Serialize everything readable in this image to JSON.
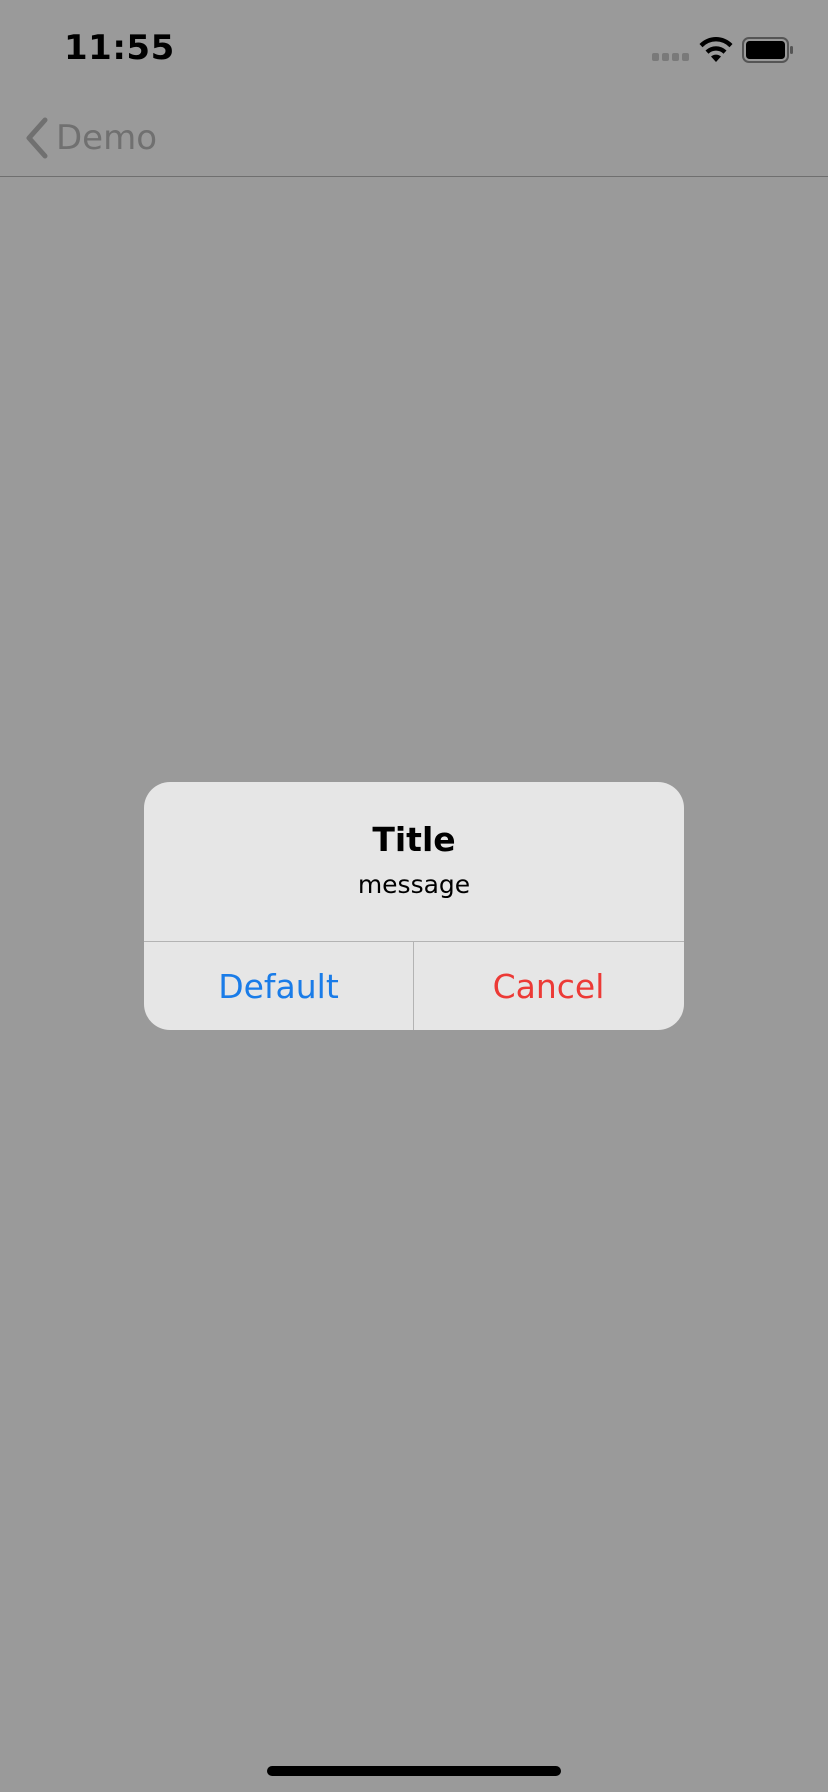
{
  "status_bar": {
    "time": "11:55"
  },
  "nav_bar": {
    "back_label": "Demo"
  },
  "alert": {
    "title": "Title",
    "message": "message",
    "buttons": [
      {
        "label": "Default",
        "color": "#1a7ce8"
      },
      {
        "label": "Cancel",
        "color": "#ec3a36"
      }
    ]
  },
  "colors": {
    "dimmed_background": "#9a9a9a",
    "alert_background": "#e6e6e6"
  }
}
